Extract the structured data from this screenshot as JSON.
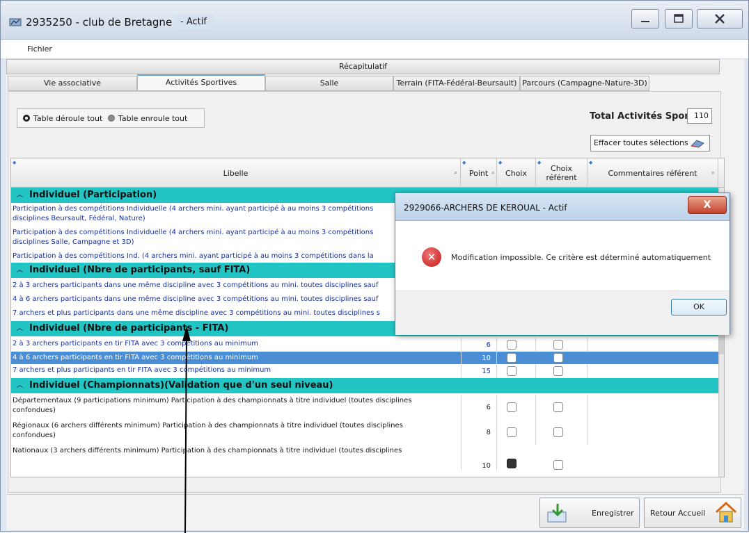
{
  "window": {
    "title": "2935250 - club de Bretagne",
    "status": "- Actif"
  },
  "menu": {
    "file": "Fichier"
  },
  "tabs": {
    "recap": "Récapitulatif",
    "items": [
      {
        "label": "Vie associative"
      },
      {
        "label": "Activités Sportives"
      },
      {
        "label": "Salle"
      },
      {
        "label": "Terrain (FITA-Fédéral-Beursault)"
      },
      {
        "label": "Parcours (Campagne-Nature-3D)"
      }
    ]
  },
  "options": {
    "expand_all": "Table déroule tout",
    "collapse_all": "Table enroule tout",
    "total_label": "Total Activités Sporti",
    "total_value": "110",
    "clear_button": "Effacer toutes sélections"
  },
  "grid": {
    "headers": {
      "libelle": "Libelle",
      "point": "Point",
      "choix": "Choix",
      "choix_referent": "Choix référent",
      "commentaires": "Commentaires référent"
    },
    "groups": [
      "Individuel (Participation)",
      "Individuel (Nbre de participants, sauf FITA)",
      "Individuel (Nbre de participants - FITA)",
      "Individuel (Championnats)(Validation que d'un seul niveau)"
    ],
    "rows": [
      {
        "libelle": "Participation à des compétitions Individuelle (4 archers mini. ayant participé à au moins 3 compétitions",
        "line2": "disciplines Beursault, Fédéral, Nature)"
      },
      {
        "libelle": "Participation à des compétitions Individuelle (4 archers mini. ayant participé à au moins 3 compétitions",
        "line2": "disciplines Salle, Campagne et 3D)"
      },
      {
        "libelle": "Participation à des compétitions Ind. (4 archers mini. ayant participé à au moins 3 compétitions dans la"
      },
      {
        "libelle": "2 à 3 archers participants dans une même discipline avec 3 compétitions au mini. toutes disciplines sauf"
      },
      {
        "libelle": "4 à 6 archers participants dans une même discipline avec 3 compétitions au mini. toutes disciplines sauf"
      },
      {
        "libelle": "7 archers et plus participants dans une même discipline avec 3 compétitions au mini. toutes disciplines s"
      },
      {
        "libelle": "2 à 3 archers participants en tir FITA avec 3 compétitions au minimum",
        "point": "6"
      },
      {
        "libelle": "4 à 6 archers participants en tir FITA avec 3 compétitions au minimum",
        "point": "10"
      },
      {
        "libelle": "7 archers et plus participants en tir FITA avec 3 compétitions au minimum",
        "point": "15"
      },
      {
        "libelle": "Départementaux (9 participations minimum) Participation à des championnats à titre individuel (toutes disciplines",
        "line2": "confondues)",
        "point": "6"
      },
      {
        "libelle": "Régionaux (6 archers différents minimum) Participation à des championnats à titre individuel (toutes disciplines",
        "line2": "confondues)",
        "point": "8"
      },
      {
        "libelle": "Nationaux (3 archers différents minimum) Participation à des championnats à titre individuel (toutes disciplines",
        "point": "10"
      }
    ]
  },
  "footer": {
    "save": "Enregistrer",
    "home": "Retour Accueil"
  },
  "dialog": {
    "title": "2929066-ARCHERS DE KEROUAL - Actif",
    "message": "Modification impossible. Ce critère est déterminé automatiquement",
    "ok": "OK",
    "close": "X",
    "error_glyph": "✕"
  }
}
